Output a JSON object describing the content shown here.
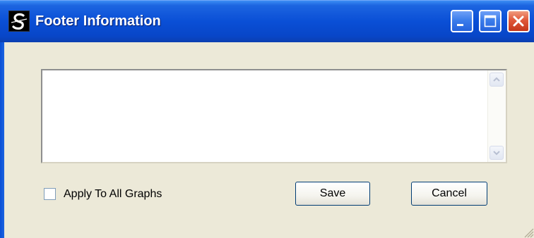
{
  "window": {
    "title": "Footer Information",
    "icon": "app-logo-icon",
    "controls": [
      "minimize-icon",
      "maximize-icon",
      "close-icon"
    ]
  },
  "footer_text": {
    "value": "",
    "scroll_up_icon": "chevron-up-icon",
    "scroll_down_icon": "chevron-down-icon"
  },
  "options": {
    "apply_all_label": "Apply To All Graphs",
    "apply_all_checked": false
  },
  "buttons": {
    "save_label": "Save",
    "cancel_label": "Cancel"
  },
  "colors": {
    "titlebar": "#0A4FD6",
    "close_button": "#E0583A",
    "dialog_background": "#ECE9D8"
  }
}
